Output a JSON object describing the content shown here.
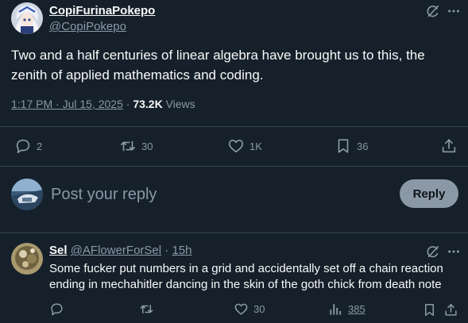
{
  "post": {
    "display_name": "CopiFurinaPokepo",
    "handle": "@CopiPokepo",
    "text": "Two and a half centuries of linear algebra have brought us to this, the zenith of applied mathematics and coding.",
    "timestamp": "1:17 PM · Jul 15, 2025",
    "separator": " · ",
    "views_count": "73.2K",
    "views_label": " Views",
    "actions": {
      "replies": "2",
      "reposts": "30",
      "likes": "1K",
      "bookmarks": "36"
    },
    "icons": [
      "grok-icon",
      "more-icon",
      "reply-icon",
      "repost-icon",
      "like-icon",
      "bookmark-icon",
      "share-icon"
    ]
  },
  "composer": {
    "placeholder": "Post your reply",
    "button_label": "Reply"
  },
  "reply": {
    "display_name": "Sel",
    "handle": "@AFlowerForSel",
    "separator": " · ",
    "time": "15h",
    "text": "Some fucker put numbers in a grid and accidentally set off a chain reaction ending in mechahitler dancing in the skin of the goth chick from death note",
    "actions": {
      "replies": "",
      "reposts": "",
      "likes": "30",
      "views": "385"
    }
  },
  "colors": {
    "background": "#15202b",
    "text_primary": "#f7f9f9",
    "text_secondary": "#8b98a5",
    "divider": "#38444d",
    "reply_button_bg": "#8b98a5"
  }
}
